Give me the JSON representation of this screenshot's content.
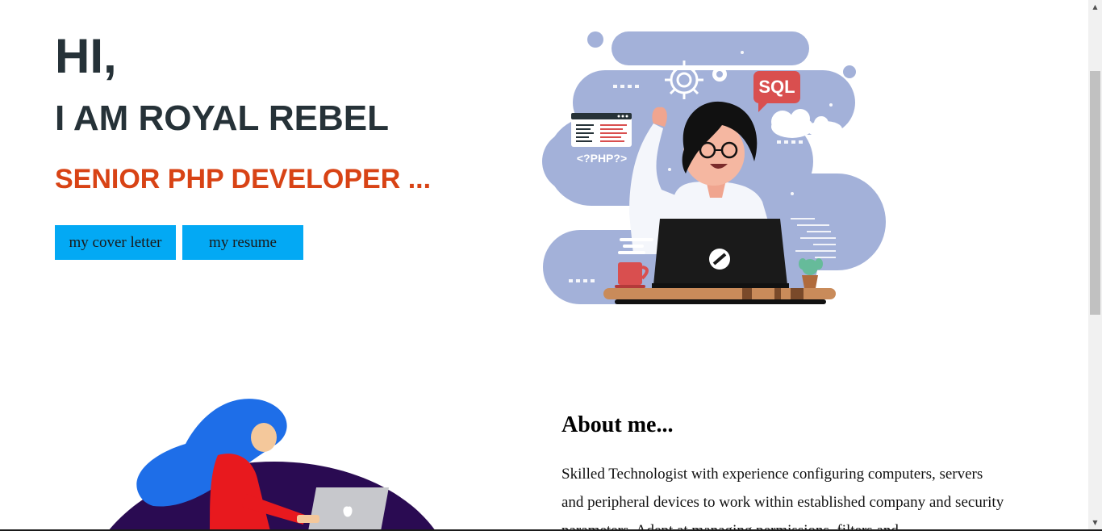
{
  "hero": {
    "greeting": "HI,",
    "name": "I AM ROYAL REBEL",
    "role": "SENIOR PHP DEVELOPER ...",
    "buttons": {
      "cover_letter": "my cover letter",
      "resume": "my resume"
    },
    "illustration": {
      "sql_label": "SQL",
      "php_label": "<?PHP?>"
    }
  },
  "about": {
    "title": "About me...",
    "text": "Skilled Technologist with experience configuring computers, servers and peripheral devices to work within established company and security parameters. Adept at managing permissions, filters and"
  },
  "colors": {
    "heading": "#263238",
    "accent": "#d84315",
    "button": "#03a9f4",
    "blob": "#a3b1d9"
  }
}
